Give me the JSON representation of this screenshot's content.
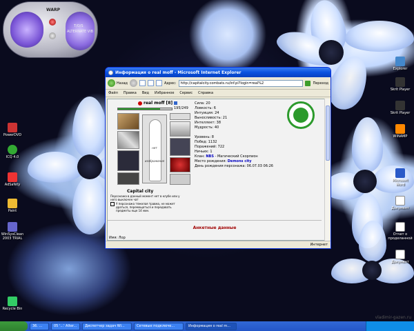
{
  "player": {
    "brand": "WARP",
    "label1": "T/O/S",
    "label2": "ALTERNATE VIB"
  },
  "desktop_icons_left": [
    {
      "name": "mycomputer",
      "label": "PowerDVD"
    },
    {
      "name": "icq",
      "label": "ICQ 4.0"
    },
    {
      "name": "aid",
      "label": "AdSafety"
    },
    {
      "name": "paint",
      "label": "Paint"
    },
    {
      "name": "winsys",
      "label": "WinSysClean 2003 TRIAL"
    },
    {
      "name": "recycle",
      "label": "Recycle Bin"
    }
  ],
  "desktop_icons_right": [
    {
      "label": "Explorer"
    },
    {
      "label": "Skrit Player"
    },
    {
      "label": "Skrit Player"
    },
    {
      "label": "WINAMP"
    },
    {
      "label": "Microsoft Word"
    },
    {
      "label": "Документ"
    },
    {
      "label": "Отчет о проделанной"
    },
    {
      "label": "Документ"
    }
  ],
  "window": {
    "title": "Информация о real moff - Microsoft Internet Explorer",
    "back_label": "Назад",
    "address_label": "Адрес:",
    "address_value": "http://capitalcity.combats.ru/inf.pl?login=real%2",
    "go_label": "Переход",
    "menu": [
      "Файл",
      "Правка",
      "Вид",
      "Избранное",
      "Сервис",
      "Справка"
    ],
    "status_left": "",
    "status_right": "Интернет"
  },
  "character": {
    "name": "real moff",
    "level": "[8]",
    "hp": "195/249",
    "hp_fraction": 0.78,
    "no_image": "нет изображения",
    "city": "Capital city",
    "note": "Персонажа в данный момент нет в клубе или у него выключен чат",
    "warning": "У персонажа тяжелая травма, не может драться, перемещаться и передавать предметы еще 14 мин."
  },
  "stats": [
    "Сила: 20",
    "Ловкость: 6",
    "Интуиция: 24",
    "Выносливость: 21",
    "Интеллект: 38",
    "Мудрость: 40"
  ],
  "info": {
    "level": "Уровень: 8",
    "wins": "Побед: 1132",
    "losses": "Поражений: 722",
    "draws": "Ничьих: 1",
    "clan_prefix": "Клан:",
    "clan_link": "NBS",
    "clan_suffix": "- Магический Скорпион",
    "birth_prefix": "Место рождения:",
    "birth_city": "Demons city",
    "birthday": "День рождения персонажа: 06.07.03 06:26"
  },
  "anket": "Анкетные данные",
  "imya": "Имя: Лор",
  "taskbar": {
    "tasks": [
      "36. ...",
      "05 '...' Alter...",
      "Диспетчер задач Wi...",
      "Сетевые подключе...",
      "Информация о real m..."
    ],
    "clock": ""
  },
  "watermark": "vladimir-gazen.ru",
  "colors": {
    "accent": "#0a52e0",
    "clan_green": "#2c9a2c",
    "anket_red": "#a00000"
  }
}
